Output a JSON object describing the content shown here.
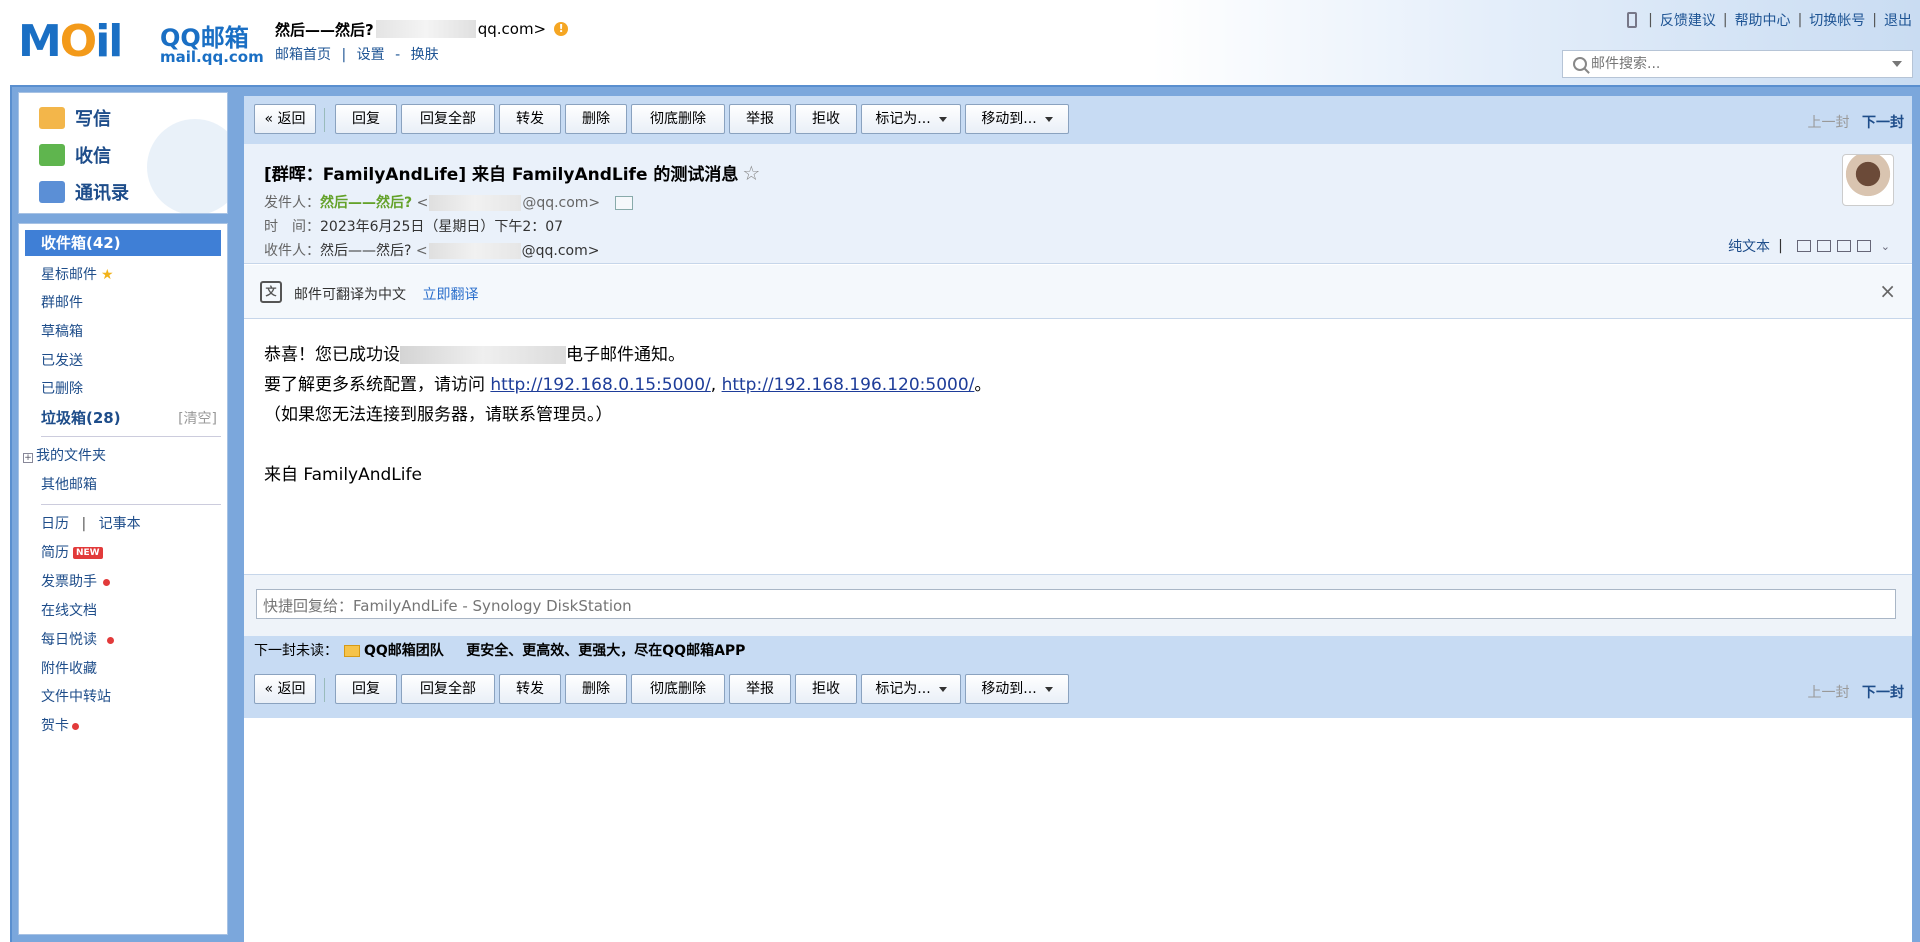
{
  "header": {
    "logo_mark": "MOil",
    "logo_brand": "QQ邮箱",
    "logo_domain": "mail.qq.com",
    "user_name": "然后——然后?",
    "user_email_suffix": "qq.com>",
    "links": {
      "home": "邮箱首页",
      "settings": "设置",
      "skin": "换肤"
    },
    "top_right": {
      "feedback": "反馈建议",
      "help": "帮助中心",
      "switch": "切换帐号",
      "logout": "退出"
    },
    "search_placeholder": "邮件搜索..."
  },
  "left": {
    "actions": {
      "compose": "写信",
      "receive": "收信",
      "contacts": "通讯录"
    },
    "folders": {
      "inbox": "收件箱(42)",
      "starred": "星标邮件",
      "group": "群邮件",
      "drafts": "草稿箱",
      "sent": "已发送",
      "deleted": "已删除",
      "spam": "垃圾箱(28)",
      "spam_clear": "[清空]",
      "my_folders": "我的文件夹",
      "other_mail": "其他邮箱",
      "calendar": "日历",
      "notebook": "记事本",
      "resume": "简历",
      "new_badge": "NEW",
      "invoice": "发票助手",
      "docs": "在线文档",
      "daily": "每日悦读",
      "attachments": "附件收藏",
      "transfer": "文件中转站",
      "cards": "贺卡"
    }
  },
  "toolbar": {
    "back": "« 返回",
    "reply": "回复",
    "reply_all": "回复全部",
    "forward": "转发",
    "delete": "删除",
    "purge": "彻底删除",
    "report": "举报",
    "reject": "拒收",
    "mark_as": "标记为...",
    "move_to": "移动到...",
    "prev": "上一封",
    "next": "下一封"
  },
  "mail": {
    "subject": "[群晖：FamilyAndLife] 来自 FamilyAndLife 的测试消息",
    "from_label": "发件人：",
    "from_name": "然后——然后?",
    "from_prefix": "<",
    "from_suffix": "@qq.com>",
    "time_label": "时　间：",
    "time_value": "2023年6月25日（星期日）下午2：07",
    "to_label": "收件人：",
    "to_name": "然后——然后?",
    "to_prefix": "<",
    "to_suffix": "@qq.com>",
    "plain_text": "纯文本",
    "translate_notice": "邮件可翻译为中文",
    "translate_action": "立即翻译",
    "body_line1_pre": "恭喜！您已成功设",
    "body_line1_post": "电子邮件通知。",
    "body_line2_pre": "要了解更多系统配置，请访问 ",
    "link1": "http://192.168.0.15:5000/",
    "comma": ", ",
    "link2": "http://192.168.196.120:5000/",
    "period": "。",
    "body_line3": "（如果您无法连接到服务器，请联系管理员。）",
    "body_line4": "来自 FamilyAndLife"
  },
  "reply": {
    "placeholder": "快捷回复给：FamilyAndLife - Synology DiskStation",
    "next_unread_label": "下一封未读：",
    "next_unread_sender": "QQ邮箱团队",
    "next_unread_subject": "更安全、更高效、更强大，尽在QQ邮箱APP"
  }
}
